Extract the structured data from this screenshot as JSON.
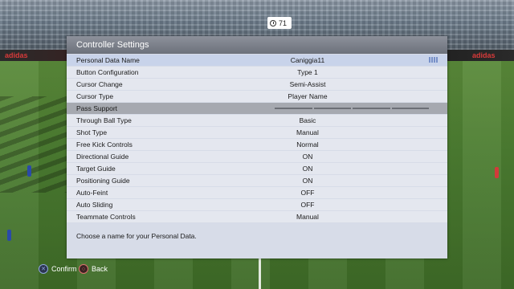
{
  "hud": {
    "clock_value": "71"
  },
  "ads": {
    "left": "adidas",
    "right": "adidas"
  },
  "panel": {
    "title": "Controller Settings",
    "rows": [
      {
        "label": "Personal Data Name",
        "value": "Caniggia11"
      },
      {
        "label": "Button Configuration",
        "value": "Type 1"
      },
      {
        "label": "Cursor Change",
        "value": "Semi-Assist"
      },
      {
        "label": "Cursor Type",
        "value": "Player Name"
      },
      {
        "label": "Pass Support",
        "value": ""
      },
      {
        "label": "Through Ball Type",
        "value": "Basic"
      },
      {
        "label": "Shot Type",
        "value": "Manual"
      },
      {
        "label": "Free Kick Controls",
        "value": "Normal"
      },
      {
        "label": "Directional Guide",
        "value": "ON"
      },
      {
        "label": "Target Guide",
        "value": "ON"
      },
      {
        "label": "Positioning Guide",
        "value": "ON"
      },
      {
        "label": "Auto-Feint",
        "value": "OFF"
      },
      {
        "label": "Auto Sliding",
        "value": "OFF"
      },
      {
        "label": "Teammate Controls",
        "value": "Manual"
      }
    ],
    "help_text": "Choose a name for your Personal Data."
  },
  "footer": {
    "confirm_label": "Confirm",
    "back_label": "Back"
  },
  "colors": {
    "panel_bg": "#d7dce8",
    "header_bg": "#6c717b",
    "selected_row": "#c8d3ea",
    "section_row": "#a6a9b0"
  },
  "icons": {
    "clock": "clock-icon",
    "keyboard": "keyboard-icon",
    "confirm": "cross-button-icon",
    "back": "circle-button-icon"
  }
}
